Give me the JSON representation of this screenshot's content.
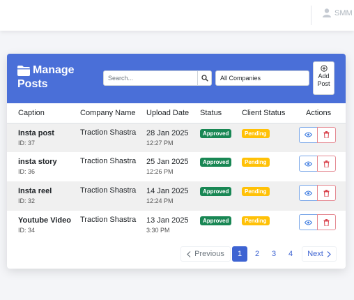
{
  "topbar": {
    "user_label": "SMM"
  },
  "header": {
    "title_line1": "Manage",
    "title_line2": "Posts",
    "search_placeholder": "Search...",
    "company_filter": "All Companies",
    "add_line1": "Add",
    "add_line2": "Post"
  },
  "table": {
    "columns": [
      "Caption",
      "Company Name",
      "Upload Date",
      "Status",
      "Client Status",
      "Actions"
    ],
    "rows": [
      {
        "caption": "Insta post",
        "id": "ID: 37",
        "company": "Traction Shastra",
        "date": "28 Jan 2025",
        "time": "12:27 PM",
        "status": "Approved",
        "client_status": "Pending"
      },
      {
        "caption": "insta story",
        "id": "ID: 36",
        "company": "Traction Shastra",
        "date": "25 Jan 2025",
        "time": "12:26 PM",
        "status": "Approved",
        "client_status": "Pending"
      },
      {
        "caption": "Insta reel",
        "id": "ID: 32",
        "company": "Traction Shastra",
        "date": "14 Jan 2025",
        "time": "12:24 PM",
        "status": "Approved",
        "client_status": "Pending"
      },
      {
        "caption": "Youtube Video",
        "id": "ID: 34",
        "company": "Traction Shastra",
        "date": "13 Jan 2025",
        "time": "3:30 PM",
        "status": "Approved",
        "client_status": "Pending"
      }
    ]
  },
  "pagination": {
    "previous": "Previous",
    "pages": [
      "1",
      "2",
      "3",
      "4"
    ],
    "next": "Next",
    "current": "1"
  },
  "colors": {
    "accent": "#4a6fd8",
    "approved": "#198754",
    "pending": "#ffc107"
  },
  "icons": [
    "user-icon",
    "folder-icon",
    "search-icon",
    "plus-circle-icon",
    "eye-icon",
    "trash-icon",
    "chevron-left-icon",
    "chevron-right-icon"
  ]
}
